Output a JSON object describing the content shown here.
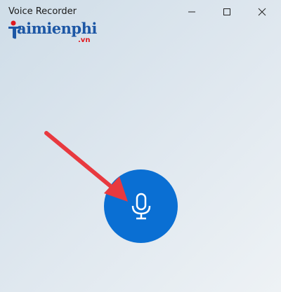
{
  "window": {
    "title": "Voice Recorder"
  },
  "watermark": {
    "brand": "aimienphi",
    "suffix": ".vn"
  },
  "icons": {
    "minimize": "minimize-icon",
    "maximize": "maximize-icon",
    "close": "close-icon",
    "record": "microphone-icon",
    "annotation": "red-arrow-annotation"
  },
  "colors": {
    "accent": "#0a6fd3",
    "arrow": "#e8393f",
    "logo_blue": "#1d57a5",
    "logo_red": "#e0191f"
  }
}
